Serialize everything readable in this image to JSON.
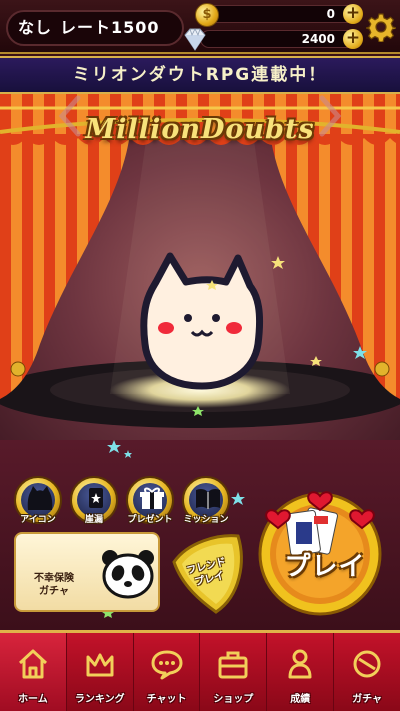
{
  "header": {
    "player_name": "なし",
    "rate": "レート1500",
    "coins": "0",
    "gems": "2400"
  },
  "banner": {
    "text": "ミリオンダウトRPG連載中！"
  },
  "stage": {
    "logo": "MillionDoubts"
  },
  "menu": {
    "icon_label": "アイコン",
    "stamp_label": "崖漏",
    "present_label": "プレゼント",
    "mission_label": "ミッション"
  },
  "gacha_card": {
    "line1": "不幸保険",
    "line2": "ガチャ"
  },
  "friend_play": {
    "line1": "フレンド",
    "line2": "プレイ"
  },
  "play": {
    "label": "プレイ"
  },
  "nav": {
    "items": [
      {
        "label": "ホーム",
        "icon": "home-icon"
      },
      {
        "label": "ランキング",
        "icon": "crown-icon"
      },
      {
        "label": "チャット",
        "icon": "chat-icon"
      },
      {
        "label": "ショップ",
        "icon": "shop-bag-icon"
      },
      {
        "label": "成績",
        "icon": "person-icon"
      },
      {
        "label": "ガチャ",
        "icon": "gacha-icon"
      }
    ]
  },
  "colors": {
    "curtain": "#e8401c",
    "curtain_stripe": "#f08a2a",
    "gold": "#e2b32c",
    "nav_red": "#c3122a",
    "banner_navy": "#221450"
  }
}
